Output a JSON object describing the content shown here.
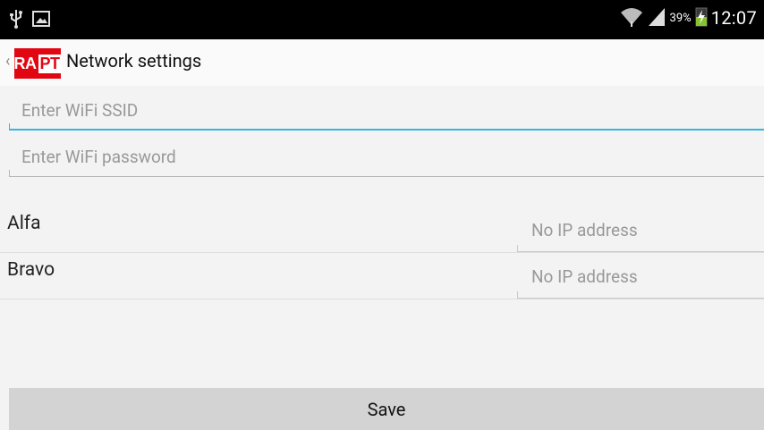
{
  "status_bar": {
    "icons_left": [
      "usb-icon",
      "gallery-icon"
    ],
    "icons_right": [
      "wifi-icon",
      "signal-icon",
      "battery-charging-icon"
    ],
    "battery_percent": "39%",
    "time": "12:07"
  },
  "action_bar": {
    "logo_text": "RAPT",
    "title": "Network settings"
  },
  "form": {
    "ssid_placeholder": "Enter WiFi SSID",
    "password_placeholder": "Enter WiFi password"
  },
  "devices": [
    {
      "name": "Alfa",
      "ip": "No IP address"
    },
    {
      "name": "Bravo",
      "ip": "No IP address"
    }
  ],
  "save_label": "Save",
  "colors": {
    "focus_accent": "#33b5e5",
    "logo_red": "#e20613"
  }
}
